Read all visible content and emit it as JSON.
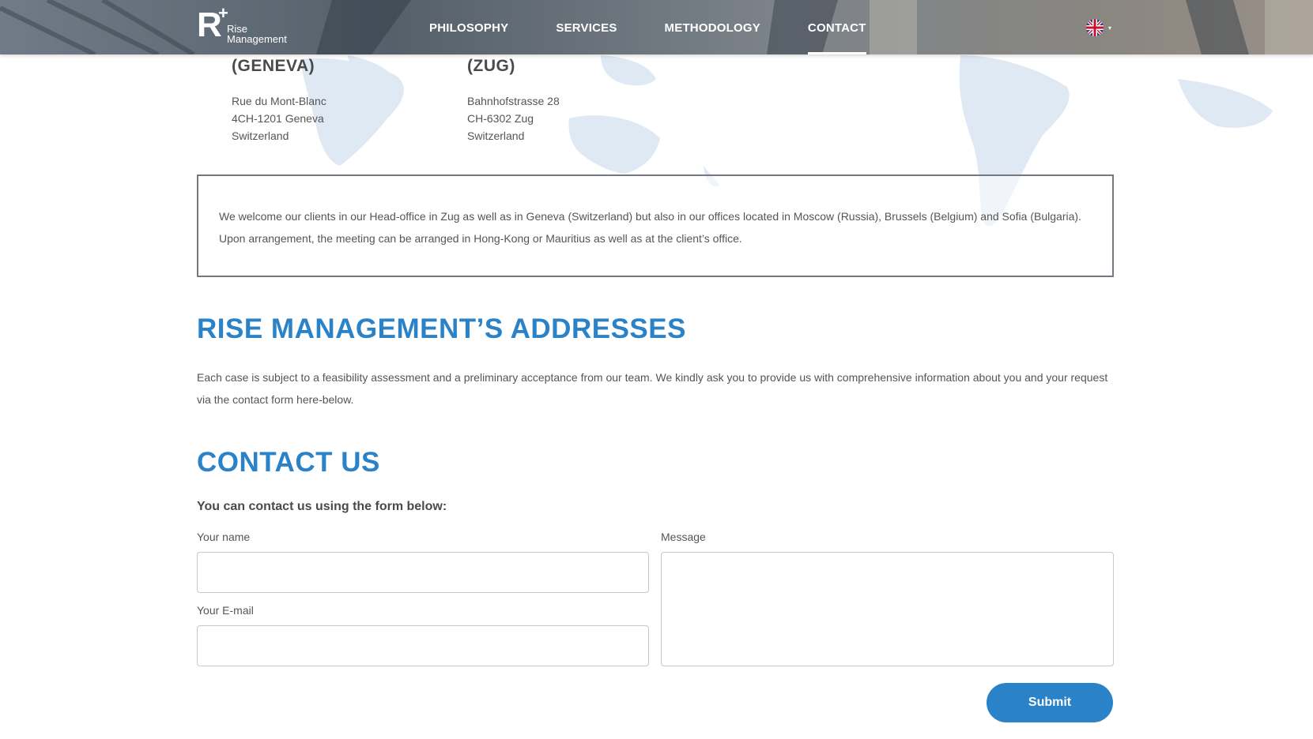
{
  "header": {
    "logo": {
      "mark": "R",
      "plus": "+",
      "line1": "Rise",
      "line2": "Management"
    },
    "nav": [
      {
        "label": "PHILOSOPHY"
      },
      {
        "label": "SERVICES"
      },
      {
        "label": "METHODOLOGY"
      },
      {
        "label": "CONTACT",
        "active": true
      }
    ],
    "language": {
      "icon": "uk-flag-icon",
      "caret": "▾"
    }
  },
  "offices": [
    {
      "title": "(GENEVA)",
      "lines": [
        "Rue du Mont-Blanc",
        "4CH-1201 Geneva",
        "Switzerland"
      ]
    },
    {
      "title": "(ZUG)",
      "lines": [
        "Bahnhofstrasse 28",
        "CH-6302 Zug",
        "Switzerland"
      ]
    }
  ],
  "notice": "We welcome our clients in our Head-office in Zug as well as in Geneva (Switzerland) but also in our offices located in Moscow (Russia), Brussels (Belgium) and Sofia (Bulgaria). Upon arrangement, the meeting can be arranged in Hong-Kong or Mauritius as well as at the client’s office.",
  "addresses": {
    "title": "RISE MANAGEMENT’S ADDRESSES",
    "text": "Each case is subject to a feasibility assessment and a preliminary acceptance from our team. We kindly ask you to provide us with comprehensive information about you and your request via the contact form here-below."
  },
  "contact": {
    "title": "CONTACT US",
    "intro": "You can contact us using the form below:",
    "name_label": "Your name",
    "name_value": "",
    "email_label": "Your E-mail",
    "email_value": "",
    "message_label": "Message",
    "message_value": "",
    "submit_label": "Submit"
  },
  "colors": {
    "accent": "#2a82c9",
    "text": "#4a4a4a",
    "border": "#737880"
  }
}
